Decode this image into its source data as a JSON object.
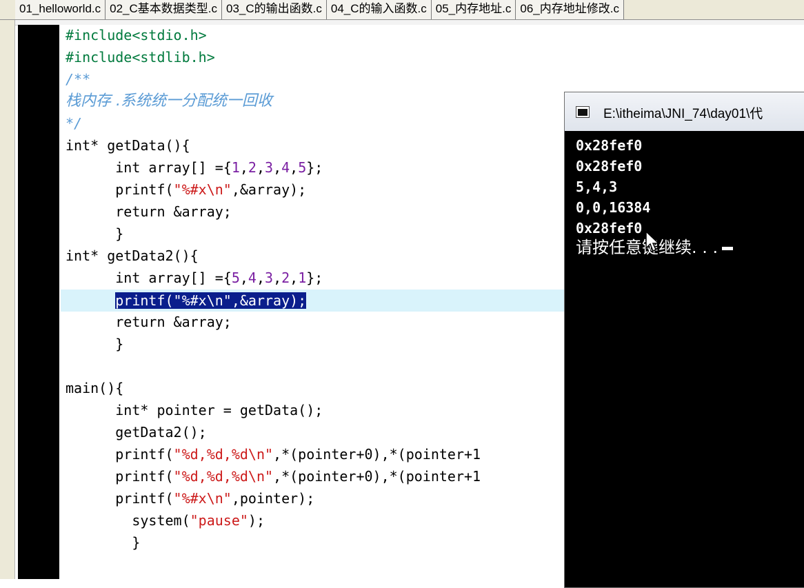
{
  "tabs": [
    {
      "label": "01_helloworld.c"
    },
    {
      "label": "02_C基本数据类型.c"
    },
    {
      "label": "03_C的输出函数.c"
    },
    {
      "label": "04_C的输入函数.c"
    },
    {
      "label": "05_内存地址.c"
    },
    {
      "label": "06_内存地址修改.c"
    }
  ],
  "code": {
    "l1": {
      "pp": "#include<stdio.h>"
    },
    "l2": {
      "pp": "#include<stdlib.h>"
    },
    "l3": {
      "cm": "/**"
    },
    "l4": {
      "cm": "栈内存 .系统统一分配统一回收"
    },
    "l5": {
      "cm": "*/"
    },
    "l6": {
      "text": "int* getData(){"
    },
    "l7": {
      "a": "      int array[] ={",
      "n1": "1",
      "c1": ",",
      "n2": "2",
      "c2": ",",
      "n3": "3",
      "c3": ",",
      "n4": "4",
      "c4": ",",
      "n5": "5",
      "b": "};"
    },
    "l8": {
      "a": "      printf(",
      "s": "\"%#x\\n\"",
      "b": ",&array);"
    },
    "l9": {
      "text": "      return &array;"
    },
    "l10": {
      "text": "      }"
    },
    "l11": {
      "text": "int* getData2(){"
    },
    "l12": {
      "a": "      int array[] ={",
      "n1": "5",
      "c1": ",",
      "n2": "4",
      "c2": ",",
      "n3": "3",
      "c3": ",",
      "n4": "2",
      "c4": ",",
      "n5": "1",
      "b": "};"
    },
    "l13": {
      "indent": "      ",
      "sel": "printf(\"%#x\\n\",&array);"
    },
    "l14": {
      "text": "      return &array;"
    },
    "l15": {
      "text": "      }"
    },
    "l16": {
      "text": "main(){"
    },
    "l17": {
      "text": "      int* pointer = getData();"
    },
    "l18": {
      "text": "      getData2();"
    },
    "l19": {
      "a": "      printf(",
      "s": "\"%d,%d,%d\\n\"",
      "b": ",*(pointer+0),*(pointer+1"
    },
    "l20": {
      "a": "      printf(",
      "s": "\"%d,%d,%d\\n\"",
      "b": ",*(pointer+0),*(pointer+1"
    },
    "l21": {
      "a": "      printf(",
      "s": "\"%#x\\n\"",
      "b": ",pointer);"
    },
    "l22": {
      "a": "        system(",
      "s": "\"pause\"",
      "b": ");"
    },
    "l23": {
      "text": "        }"
    }
  },
  "console": {
    "title": "E:\\itheima\\JNI_74\\day01\\代",
    "lines": [
      "0x28fef0",
      "0x28fef0",
      "5,4,3",
      "0,0,16384",
      "0x28fef0"
    ],
    "prompt": "请按任意键继续. . ."
  }
}
